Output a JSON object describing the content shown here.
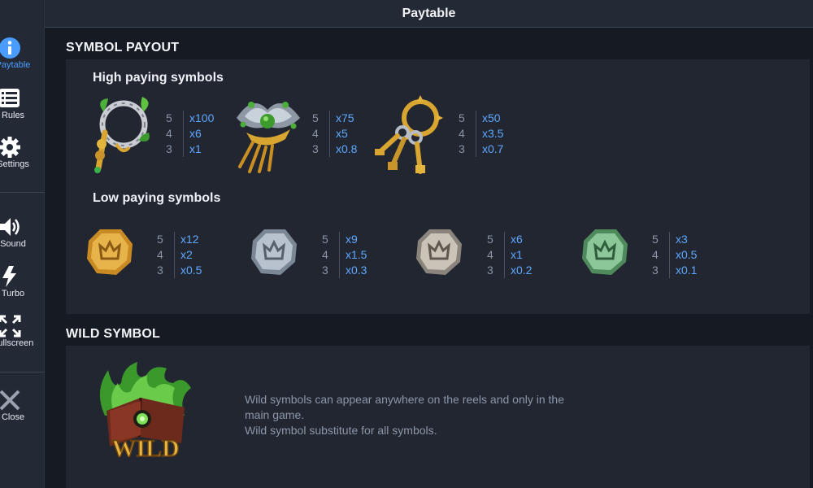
{
  "header": {
    "title": "Paytable"
  },
  "sidebar": {
    "items": [
      {
        "label": "Paytable",
        "icon": "info-icon"
      },
      {
        "label": "Rules",
        "icon": "list-icon"
      },
      {
        "label": "Settings",
        "icon": "gear-icon"
      },
      {
        "label": "Sound",
        "icon": "speaker-icon"
      },
      {
        "label": "Turbo",
        "icon": "lightning-icon"
      },
      {
        "label": "Fullscreen",
        "icon": "expand-icon"
      },
      {
        "label": "Close",
        "icon": "close-icon"
      }
    ]
  },
  "symbol_payout": {
    "title": "SYMBOL PAYOUT",
    "high_title": "High paying symbols",
    "low_title": "Low paying symbols",
    "high": [
      {
        "name": "wreath",
        "pays": [
          {
            "count": "5",
            "value": "x100"
          },
          {
            "count": "4",
            "value": "x6"
          },
          {
            "count": "3",
            "value": "x1"
          }
        ]
      },
      {
        "name": "comb",
        "pays": [
          {
            "count": "5",
            "value": "x75"
          },
          {
            "count": "4",
            "value": "x5"
          },
          {
            "count": "3",
            "value": "x0.8"
          }
        ]
      },
      {
        "name": "keys",
        "pays": [
          {
            "count": "5",
            "value": "x50"
          },
          {
            "count": "4",
            "value": "x3.5"
          },
          {
            "count": "3",
            "value": "x0.7"
          }
        ]
      }
    ],
    "low": [
      {
        "name": "gold-coin",
        "pays": [
          {
            "count": "5",
            "value": "x12"
          },
          {
            "count": "4",
            "value": "x2"
          },
          {
            "count": "3",
            "value": "x0.5"
          }
        ]
      },
      {
        "name": "silver-coin",
        "pays": [
          {
            "count": "5",
            "value": "x9"
          },
          {
            "count": "4",
            "value": "x1.5"
          },
          {
            "count": "3",
            "value": "x0.3"
          }
        ]
      },
      {
        "name": "pewter-coin",
        "pays": [
          {
            "count": "5",
            "value": "x6"
          },
          {
            "count": "4",
            "value": "x1"
          },
          {
            "count": "3",
            "value": "x0.2"
          }
        ]
      },
      {
        "name": "jade-coin",
        "pays": [
          {
            "count": "5",
            "value": "x3"
          },
          {
            "count": "4",
            "value": "x0.5"
          },
          {
            "count": "3",
            "value": "x0.1"
          }
        ]
      }
    ]
  },
  "wild": {
    "title": "WILD SYMBOL",
    "badge": "WILD",
    "line1": "Wild symbols can appear anywhere on the reels and only in the main game.",
    "line2": "Wild symbol substitute for all symbols."
  },
  "colors": {
    "accent": "#4a9cff",
    "value": "#5fa8ff",
    "panel": "#212631",
    "bg": "#161a22"
  }
}
